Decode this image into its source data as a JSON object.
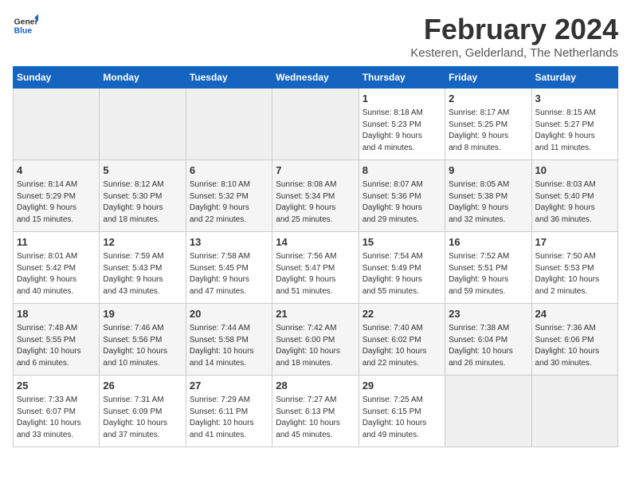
{
  "header": {
    "logo_line1": "General",
    "logo_line2": "Blue",
    "month_title": "February 2024",
    "location": "Kesteren, Gelderland, The Netherlands"
  },
  "days_of_week": [
    "Sunday",
    "Monday",
    "Tuesday",
    "Wednesday",
    "Thursday",
    "Friday",
    "Saturday"
  ],
  "weeks": [
    [
      {
        "day": "",
        "info": ""
      },
      {
        "day": "",
        "info": ""
      },
      {
        "day": "",
        "info": ""
      },
      {
        "day": "",
        "info": ""
      },
      {
        "day": "1",
        "info": "Sunrise: 8:18 AM\nSunset: 5:23 PM\nDaylight: 9 hours\nand 4 minutes."
      },
      {
        "day": "2",
        "info": "Sunrise: 8:17 AM\nSunset: 5:25 PM\nDaylight: 9 hours\nand 8 minutes."
      },
      {
        "day": "3",
        "info": "Sunrise: 8:15 AM\nSunset: 5:27 PM\nDaylight: 9 hours\nand 11 minutes."
      }
    ],
    [
      {
        "day": "4",
        "info": "Sunrise: 8:14 AM\nSunset: 5:29 PM\nDaylight: 9 hours\nand 15 minutes."
      },
      {
        "day": "5",
        "info": "Sunrise: 8:12 AM\nSunset: 5:30 PM\nDaylight: 9 hours\nand 18 minutes."
      },
      {
        "day": "6",
        "info": "Sunrise: 8:10 AM\nSunset: 5:32 PM\nDaylight: 9 hours\nand 22 minutes."
      },
      {
        "day": "7",
        "info": "Sunrise: 8:08 AM\nSunset: 5:34 PM\nDaylight: 9 hours\nand 25 minutes."
      },
      {
        "day": "8",
        "info": "Sunrise: 8:07 AM\nSunset: 5:36 PM\nDaylight: 9 hours\nand 29 minutes."
      },
      {
        "day": "9",
        "info": "Sunrise: 8:05 AM\nSunset: 5:38 PM\nDaylight: 9 hours\nand 32 minutes."
      },
      {
        "day": "10",
        "info": "Sunrise: 8:03 AM\nSunset: 5:40 PM\nDaylight: 9 hours\nand 36 minutes."
      }
    ],
    [
      {
        "day": "11",
        "info": "Sunrise: 8:01 AM\nSunset: 5:42 PM\nDaylight: 9 hours\nand 40 minutes."
      },
      {
        "day": "12",
        "info": "Sunrise: 7:59 AM\nSunset: 5:43 PM\nDaylight: 9 hours\nand 43 minutes."
      },
      {
        "day": "13",
        "info": "Sunrise: 7:58 AM\nSunset: 5:45 PM\nDaylight: 9 hours\nand 47 minutes."
      },
      {
        "day": "14",
        "info": "Sunrise: 7:56 AM\nSunset: 5:47 PM\nDaylight: 9 hours\nand 51 minutes."
      },
      {
        "day": "15",
        "info": "Sunrise: 7:54 AM\nSunset: 5:49 PM\nDaylight: 9 hours\nand 55 minutes."
      },
      {
        "day": "16",
        "info": "Sunrise: 7:52 AM\nSunset: 5:51 PM\nDaylight: 9 hours\nand 59 minutes."
      },
      {
        "day": "17",
        "info": "Sunrise: 7:50 AM\nSunset: 5:53 PM\nDaylight: 10 hours\nand 2 minutes."
      }
    ],
    [
      {
        "day": "18",
        "info": "Sunrise: 7:48 AM\nSunset: 5:55 PM\nDaylight: 10 hours\nand 6 minutes."
      },
      {
        "day": "19",
        "info": "Sunrise: 7:46 AM\nSunset: 5:56 PM\nDaylight: 10 hours\nand 10 minutes."
      },
      {
        "day": "20",
        "info": "Sunrise: 7:44 AM\nSunset: 5:58 PM\nDaylight: 10 hours\nand 14 minutes."
      },
      {
        "day": "21",
        "info": "Sunrise: 7:42 AM\nSunset: 6:00 PM\nDaylight: 10 hours\nand 18 minutes."
      },
      {
        "day": "22",
        "info": "Sunrise: 7:40 AM\nSunset: 6:02 PM\nDaylight: 10 hours\nand 22 minutes."
      },
      {
        "day": "23",
        "info": "Sunrise: 7:38 AM\nSunset: 6:04 PM\nDaylight: 10 hours\nand 26 minutes."
      },
      {
        "day": "24",
        "info": "Sunrise: 7:36 AM\nSunset: 6:06 PM\nDaylight: 10 hours\nand 30 minutes."
      }
    ],
    [
      {
        "day": "25",
        "info": "Sunrise: 7:33 AM\nSunset: 6:07 PM\nDaylight: 10 hours\nand 33 minutes."
      },
      {
        "day": "26",
        "info": "Sunrise: 7:31 AM\nSunset: 6:09 PM\nDaylight: 10 hours\nand 37 minutes."
      },
      {
        "day": "27",
        "info": "Sunrise: 7:29 AM\nSunset: 6:11 PM\nDaylight: 10 hours\nand 41 minutes."
      },
      {
        "day": "28",
        "info": "Sunrise: 7:27 AM\nSunset: 6:13 PM\nDaylight: 10 hours\nand 45 minutes."
      },
      {
        "day": "29",
        "info": "Sunrise: 7:25 AM\nSunset: 6:15 PM\nDaylight: 10 hours\nand 49 minutes."
      },
      {
        "day": "",
        "info": ""
      },
      {
        "day": "",
        "info": ""
      }
    ]
  ]
}
